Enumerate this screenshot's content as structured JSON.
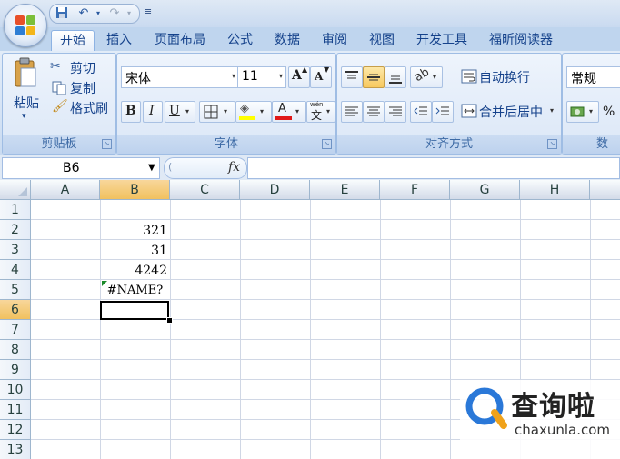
{
  "quick_access": {
    "save_icon": "save-icon",
    "undo_icon": "undo-icon",
    "redo_icon": "redo-icon",
    "more_glyph": "≡"
  },
  "tabs": [
    {
      "label": "开始",
      "active": true
    },
    {
      "label": "插入"
    },
    {
      "label": "页面布局"
    },
    {
      "label": "公式"
    },
    {
      "label": "数据"
    },
    {
      "label": "审阅"
    },
    {
      "label": "视图"
    },
    {
      "label": "开发工具"
    },
    {
      "label": "福昕阅读器"
    }
  ],
  "ribbon": {
    "clipboard": {
      "paste": "粘贴",
      "cut": "剪切",
      "copy": "复制",
      "format_painter": "格式刷",
      "group_label": "剪贴板"
    },
    "font": {
      "font_name": "宋体",
      "font_size": "11",
      "bold": "B",
      "italic": "I",
      "underline": "U",
      "grow": "A",
      "shrink": "A",
      "font_color_glyph": "A",
      "phonetic": "wén",
      "phonetic_char": "文",
      "group_label": "字体"
    },
    "alignment": {
      "wrap_text": "自动换行",
      "merge_center": "合并后居中",
      "group_label": "对齐方式"
    },
    "number": {
      "format": "常规",
      "percent": "%",
      "group_label": "数"
    }
  },
  "formula_bar": {
    "name_box": "B6",
    "fx_label": "fx",
    "formula": ""
  },
  "grid": {
    "columns": [
      "A",
      "B",
      "C",
      "D",
      "E",
      "F",
      "G",
      "H"
    ],
    "rows": [
      "1",
      "2",
      "3",
      "4",
      "5",
      "6",
      "7",
      "8",
      "9",
      "10",
      "11",
      "12",
      "13"
    ],
    "selected_column": "B",
    "selected_row": "6",
    "cells": {
      "B2": "321",
      "B3": "31",
      "B4": "4242",
      "B5": "#NAME?"
    },
    "colors": {
      "header_selected": "#f1c15f",
      "error_marker": "#1a8a2a"
    }
  },
  "watermark": {
    "cn": "查询啦",
    "en": "chaxunla.com"
  }
}
